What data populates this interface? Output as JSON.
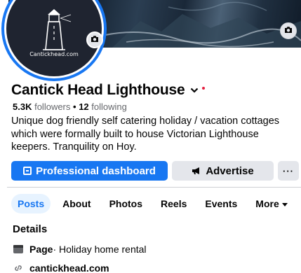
{
  "profile": {
    "page_name": "Cantick Head Lighthouse",
    "avatar_caption": "Cantickhead.com",
    "followers_count": "5.3K",
    "followers_label": "followers",
    "separator": "•",
    "following_count": "12",
    "following_label": "following",
    "bio": "Unique dog friendly self catering holiday / vacation cottages which were formally built to house Victorian Lighthouse keepers. Tranquility on Hoy."
  },
  "actions": {
    "dashboard_label": "Professional dashboard",
    "advertise_label": "Advertise",
    "more_label": "···"
  },
  "tabs": [
    {
      "label": "Posts",
      "active": true
    },
    {
      "label": "About"
    },
    {
      "label": "Photos"
    },
    {
      "label": "Reels"
    },
    {
      "label": "Events"
    },
    {
      "label": "More"
    }
  ],
  "details": {
    "title": "Details",
    "page_type_label": "Page",
    "page_type_value": " · Holiday home rental",
    "website": "cantickhead.com"
  },
  "colors": {
    "accent": "#1877f2",
    "button_gray": "#e4e6eb",
    "notification_dot": "#e41e3f"
  },
  "icons": [
    "camera-icon",
    "chevron-down-icon",
    "dashboard-icon",
    "megaphone-icon",
    "more-icon",
    "flag-icon",
    "link-icon"
  ]
}
